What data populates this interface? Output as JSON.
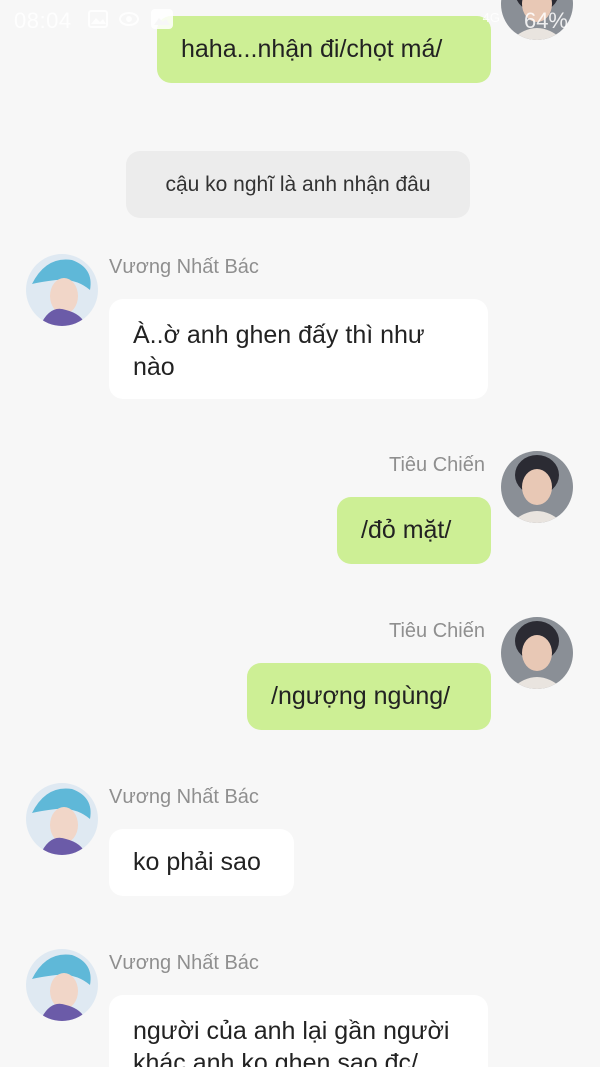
{
  "status_bar": {
    "time": "08:04",
    "battery": "64%",
    "signal": "4G"
  },
  "contacts": {
    "other": "Vương Nhất Bác",
    "self": "Tiêu Chiến"
  },
  "messages": [
    {
      "sender": "Tiêu Chiến",
      "text": "haha...nhận đi/chọt má/"
    },
    {
      "sender": "system",
      "text": "cậu ko nghĩ là anh nhận đâu"
    },
    {
      "sender": "Vương Nhất Bác",
      "text": "À..ờ anh ghen đấy thì như nào"
    },
    {
      "sender": "Tiêu Chiến",
      "text": "/đỏ mặt/"
    },
    {
      "sender": "Tiêu Chiến",
      "text": "/ngượng ngùng/"
    },
    {
      "sender": "Vương Nhất Bác",
      "text": "ko phải sao"
    },
    {
      "sender": "Vương Nhất Bác",
      "text": "người của anh lại gần người khác anh ko ghen sao đc/"
    }
  ],
  "colors": {
    "background": "#f7f7f7",
    "my_bubble": "#cdef95",
    "their_bubble": "#ffffff",
    "system_bubble": "#ececec",
    "name_text": "#8f8f8f"
  }
}
